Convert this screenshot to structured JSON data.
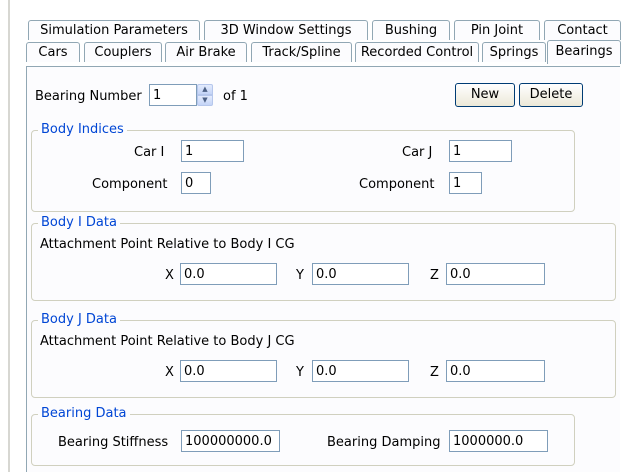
{
  "tabs_row1": [
    {
      "label": "Simulation Parameters"
    },
    {
      "label": "3D Window Settings"
    },
    {
      "label": "Bushing"
    },
    {
      "label": "Pin Joint"
    },
    {
      "label": "Contact"
    }
  ],
  "tabs_row2": [
    {
      "label": "Cars"
    },
    {
      "label": "Couplers"
    },
    {
      "label": "Air Brake"
    },
    {
      "label": "Track/Spline"
    },
    {
      "label": "Recorded Control"
    },
    {
      "label": "Springs"
    },
    {
      "label": "Bearings"
    }
  ],
  "bearing_number": {
    "label": "Bearing Number",
    "value": "1",
    "of_label": "of 1",
    "up_glyph": "▲",
    "down_glyph": "▼"
  },
  "buttons": {
    "new": "New",
    "delete": "Delete"
  },
  "body_indices": {
    "title": "Body Indices",
    "car_i_label": "Car I",
    "car_i_value": "1",
    "car_j_label": "Car J",
    "car_j_value": "1",
    "component_i_label": "Component",
    "component_i_value": "0",
    "component_j_label": "Component",
    "component_j_value": "1"
  },
  "body_i_data": {
    "title": "Body I Data",
    "caption": "Attachment Point Relative to Body I CG",
    "x_label": "X",
    "x_value": "0.0",
    "y_label": "Y",
    "y_value": "0.0",
    "z_label": "Z",
    "z_value": "0.0"
  },
  "body_j_data": {
    "title": "Body J Data",
    "caption": "Attachment Point Relative to Body J CG",
    "x_label": "X",
    "x_value": "0.0",
    "y_label": "Y",
    "y_value": "0.0",
    "z_label": "Z",
    "z_value": "0.0"
  },
  "bearing_data": {
    "title": "Bearing Data",
    "stiffness_label": "Bearing Stiffness",
    "stiffness_value": "100000000.0",
    "damping_label": "Bearing Damping",
    "damping_value": "1000000.0"
  },
  "colors": {
    "group_title": "#0046d5",
    "tab_border": "#91a7b4",
    "panel_bg": "#fcfcfe"
  }
}
